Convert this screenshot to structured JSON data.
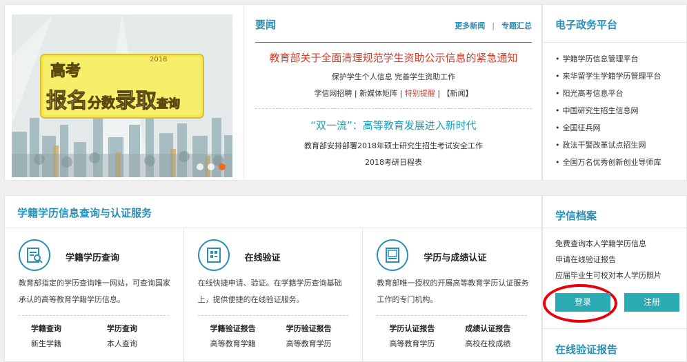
{
  "banner": {
    "year": "2018",
    "line1": "高考",
    "line2a": "报名",
    "line2b": "分数",
    "line2c": "录取",
    "line2d": "查询"
  },
  "news": {
    "title": "要闻",
    "more_news": "更多新闻",
    "separator": "|",
    "topics": "专题汇总",
    "headline1": "教育部关于全面清理规范学生资助公示信息的紧急通知",
    "sub1": "保护学生个人信息 完善学生资助工作",
    "sub2_a": "学信网招聘 | 新媒体矩阵 | ",
    "sub2_red": "特别提醒",
    "sub2_b": " | 【新闻】",
    "headline2": "“双一流”：高等教育发展进入新时代",
    "sub3": "教育部安排部署2018年硕士研究生招生考试安全工作",
    "sub4": "2018考研日程表"
  },
  "platform": {
    "title": "电子政务平台",
    "items": [
      "学籍学历信息管理平台",
      "来华留学生学籍学历管理平台",
      "阳光高考信息平台",
      "中国研究生招生信息网",
      "全国征兵网",
      "政法干警改革试点招生网",
      "全国万名优秀创新创业导师库"
    ]
  },
  "service": {
    "title": "学籍学历信息查询与认证服务",
    "cols": [
      {
        "title": "学籍学历查询",
        "desc": "教育部指定的学历查询唯一网站，可查询国家承认的高等教育学籍学历信息。",
        "h1": "学籍查询",
        "h2": "学历查询",
        "l1": "新生学籍",
        "l2": "本人查询",
        "icon": "id-card-search-icon"
      },
      {
        "title": "在线验证",
        "desc": "在线快捷申请、验证。在学籍学历查询基础上，提供便捷的在线验证服务。",
        "h1": "学籍验证报告",
        "h2": "学历验证报告",
        "l1": "高等教育学籍",
        "l2": "高等教育学历",
        "icon": "document-grid-icon"
      },
      {
        "title": "学历与成绩认证",
        "desc": "教育部唯一授权的开展高等教育学历认证服务工作的专门机构。",
        "h1": "学历认证报告",
        "h2": "成绩认证报告",
        "l1": "高等教育学历",
        "l2": "高校在校成绩",
        "icon": "certificate-icon"
      }
    ]
  },
  "archive": {
    "title": "学信档案",
    "lines": [
      "免费查询本人学籍学历信息",
      "申请在线验证报告",
      "应届毕业生可校对本人学历照片"
    ],
    "login": "登录",
    "register": "注册",
    "verify_title": "在线验证报告"
  },
  "colors": {
    "accent": "#2a8fb6",
    "button": "#2aaab3",
    "alert_red": "#d23c28",
    "annotation": "#e8000b"
  }
}
